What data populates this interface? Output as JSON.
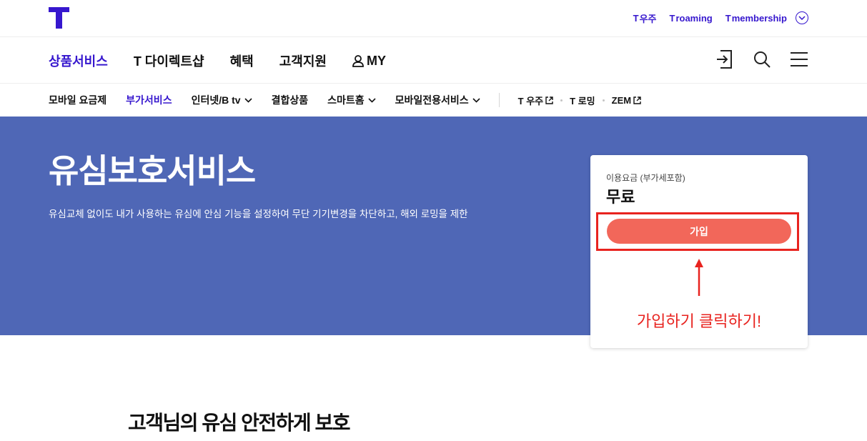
{
  "util_bar": {
    "links": [
      {
        "mark": "T",
        "label": "우주"
      },
      {
        "mark": "T",
        "label": "roaming"
      },
      {
        "mark": "T",
        "label": "membership"
      }
    ],
    "more_icon": "chevron-down-circle-icon"
  },
  "main_nav": {
    "items": [
      "상품서비스",
      "T 다이렉트샵",
      "혜택",
      "고객지원",
      "MY"
    ],
    "active_index": 0,
    "icons": [
      "login-icon",
      "search-icon",
      "menu-icon"
    ]
  },
  "sub_nav": {
    "items": [
      "모바일 요금제",
      "부가서비스",
      "인터넷/B tv",
      "결합상품",
      "스마트홈",
      "모바일전용서비스"
    ],
    "active_index": 1,
    "dropdown_indices": [
      2,
      4,
      5
    ],
    "external": [
      "T 우주",
      "T 로밍",
      "ZEM"
    ]
  },
  "hero": {
    "title": "유심보호서비스",
    "description": "유심교체 없이도 내가 사용하는 유심에 안심 기능을 설정하여 무단 기기변경을 차단하고, 해외 로밍을 제한"
  },
  "price_card": {
    "fee_label": "이용요금 (부가세포함)",
    "fee_value": "무료",
    "join_label": "가입",
    "annotation": "가입하기 클릭하기!"
  },
  "section": {
    "title": "고객님의 유심 안전하게 보호"
  },
  "colors": {
    "brand": "#3617CE",
    "hero_bg": "#4F67B6",
    "join_button": "#F2675A",
    "annotation_red": "#E8231F"
  }
}
